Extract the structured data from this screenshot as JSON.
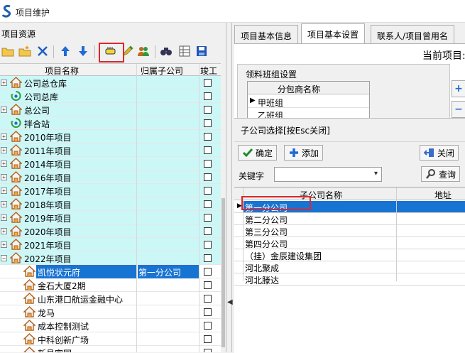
{
  "window": {
    "title": "项目维护",
    "icon": "app-logo-icon"
  },
  "left": {
    "header": "项目资源",
    "toolbar": [
      "open-folder-icon",
      "add-folder-icon",
      "delete-icon",
      "arrow-up-icon",
      "arrow-down-icon",
      "pointer-tool-icon",
      "edit-pencil-icon",
      "users-icon",
      "find-icon",
      "grid-icon",
      "save-icon"
    ],
    "columns": {
      "name": "项目名称",
      "sub": "归属子公司",
      "done": "竣工"
    },
    "rows": [
      {
        "name": "公司总仓库",
        "sub": "",
        "cyan": true,
        "level": 0,
        "exp": "+",
        "icon": "house"
      },
      {
        "name": "公司总库",
        "sub": "",
        "cyan": true,
        "level": 0,
        "exp": "",
        "icon": "cycle"
      },
      {
        "name": "总公司",
        "sub": "",
        "cyan": true,
        "level": 0,
        "exp": "+",
        "icon": "house"
      },
      {
        "name": "拌合站",
        "sub": "",
        "cyan": true,
        "level": 0,
        "exp": "",
        "icon": "cycle"
      },
      {
        "name": "2010年项目",
        "sub": "",
        "cyan": true,
        "level": 0,
        "exp": "+",
        "icon": "house"
      },
      {
        "name": "2011年项目",
        "sub": "",
        "cyan": true,
        "level": 0,
        "exp": "+",
        "icon": "house"
      },
      {
        "name": "2014年项目",
        "sub": "",
        "cyan": true,
        "level": 0,
        "exp": "+",
        "icon": "house"
      },
      {
        "name": "2016年项目",
        "sub": "",
        "cyan": true,
        "level": 0,
        "exp": "+",
        "icon": "house"
      },
      {
        "name": "2017年项目",
        "sub": "",
        "cyan": true,
        "level": 0,
        "exp": "+",
        "icon": "house"
      },
      {
        "name": "2018年项目",
        "sub": "",
        "cyan": true,
        "level": 0,
        "exp": "+",
        "icon": "house"
      },
      {
        "name": "2019年项目",
        "sub": "",
        "cyan": true,
        "level": 0,
        "exp": "+",
        "icon": "house"
      },
      {
        "name": "2020年项目",
        "sub": "",
        "cyan": true,
        "level": 0,
        "exp": "+",
        "icon": "house"
      },
      {
        "name": "2021年项目",
        "sub": "",
        "cyan": true,
        "level": 0,
        "exp": "+",
        "icon": "house"
      },
      {
        "name": "2022年项目",
        "sub": "",
        "cyan": true,
        "level": 0,
        "exp": "-",
        "icon": "house"
      },
      {
        "name": "凯悦状元府",
        "sub": "第一分公司",
        "cyan": false,
        "level": 1,
        "exp": "",
        "icon": "house",
        "selected": true
      },
      {
        "name": "金石大厦2期",
        "sub": "",
        "cyan": false,
        "level": 1,
        "exp": "",
        "icon": "house"
      },
      {
        "name": "山东港口航运金融中心",
        "sub": "",
        "cyan": false,
        "level": 1,
        "exp": "",
        "icon": "house"
      },
      {
        "name": "龙马",
        "sub": "",
        "cyan": false,
        "level": 1,
        "exp": "",
        "icon": "house"
      },
      {
        "name": "成本控制测试",
        "sub": "",
        "cyan": false,
        "level": 1,
        "exp": "",
        "icon": "house"
      },
      {
        "name": "中科创新广场",
        "sub": "",
        "cyan": false,
        "level": 1,
        "exp": "",
        "icon": "house"
      },
      {
        "name": "新昌家园",
        "sub": "",
        "cyan": false,
        "level": 1,
        "exp": "",
        "icon": "house"
      }
    ]
  },
  "tabs": [
    "项目基本信息",
    "项目基本设置",
    "联系人/项目曾用名"
  ],
  "active_tab": 1,
  "right": {
    "current_project_label": "当前项目:",
    "lingliao": {
      "label": "领料班组设置",
      "column": "分包商名称",
      "rows": [
        "甲班组",
        "乙班组"
      ]
    },
    "side_buttons": [
      "+",
      "−"
    ]
  },
  "dialog": {
    "title": "子公司选择[按Esc关闭]",
    "confirm": "确定",
    "add": "添加",
    "close": "关闭",
    "keyword_label": "关键字",
    "keyword_value": "",
    "query": "查询",
    "columns": {
      "name": "子公司名称",
      "addr": "地址"
    },
    "rows": [
      "第一分公司",
      "第二分公司",
      "第三分公司",
      "第四分公司",
      "（挂）金辰建设集团",
      "河北聚成",
      "河北滕达"
    ],
    "selected": 0
  },
  "colors": {
    "selection": "#1874d2",
    "cyan_row": "#ccf7f7",
    "highlight_box": "#e0242b"
  }
}
